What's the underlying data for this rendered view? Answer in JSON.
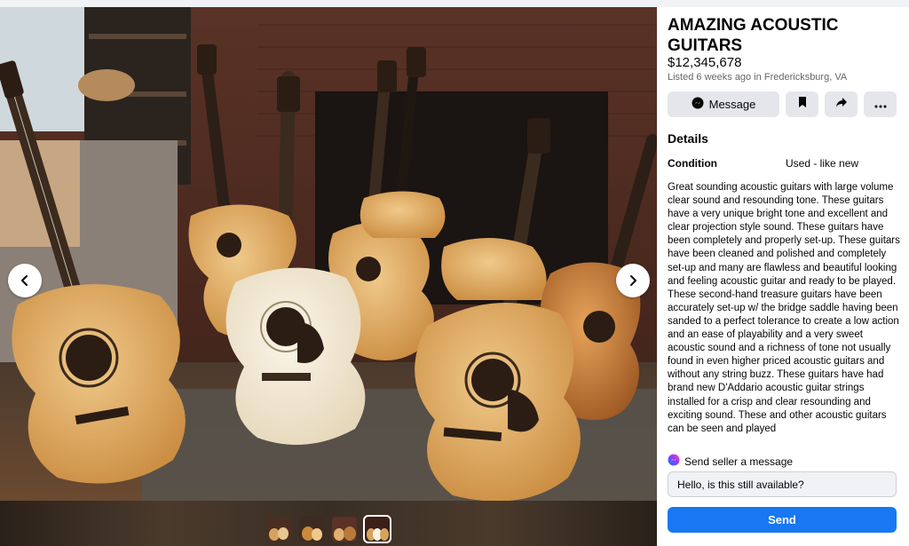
{
  "listing": {
    "title": "AMAZING ACOUSTIC GUITARS",
    "price": "$12,345,678",
    "listed": "Listed 6 weeks ago in Fredericksburg, VA"
  },
  "actions": {
    "message_label": "Message"
  },
  "details": {
    "heading": "Details",
    "condition_label": "Condition",
    "condition_value": "Used - like new",
    "description": "Great sounding acoustic guitars with large volume clear sound and resounding tone. These guitars have a very unique bright tone and excellent and clear projection style sound. These guitars have been completely and properly set-up. These guitars have been cleaned and polished and completely set-up and many are flawless and beautiful looking and feeling acoustic guitar and ready to be played. These second-hand treasure guitars have been accurately set-up w/ the bridge saddle having been sanded to a perfect tolerance to create a low action and an ease of playability and a very sweet acoustic sound and a richness of tone not usually found in even higher priced acoustic guitars and without any string buzz. These guitars have had brand new D'Addario acoustic guitar strings installed for a crisp and clear resounding and exciting sound. These and other acoustic guitars can be seen and played"
  },
  "contact": {
    "prompt": "Send seller a message",
    "input_value": "Hello, is this still available?",
    "send_label": "Send"
  },
  "gallery": {
    "thumbnail_count": 4,
    "active_index": 3
  },
  "colors": {
    "accent": "#1877f2",
    "button_gray": "#e4e6eb",
    "secondary_text": "#65676b"
  }
}
